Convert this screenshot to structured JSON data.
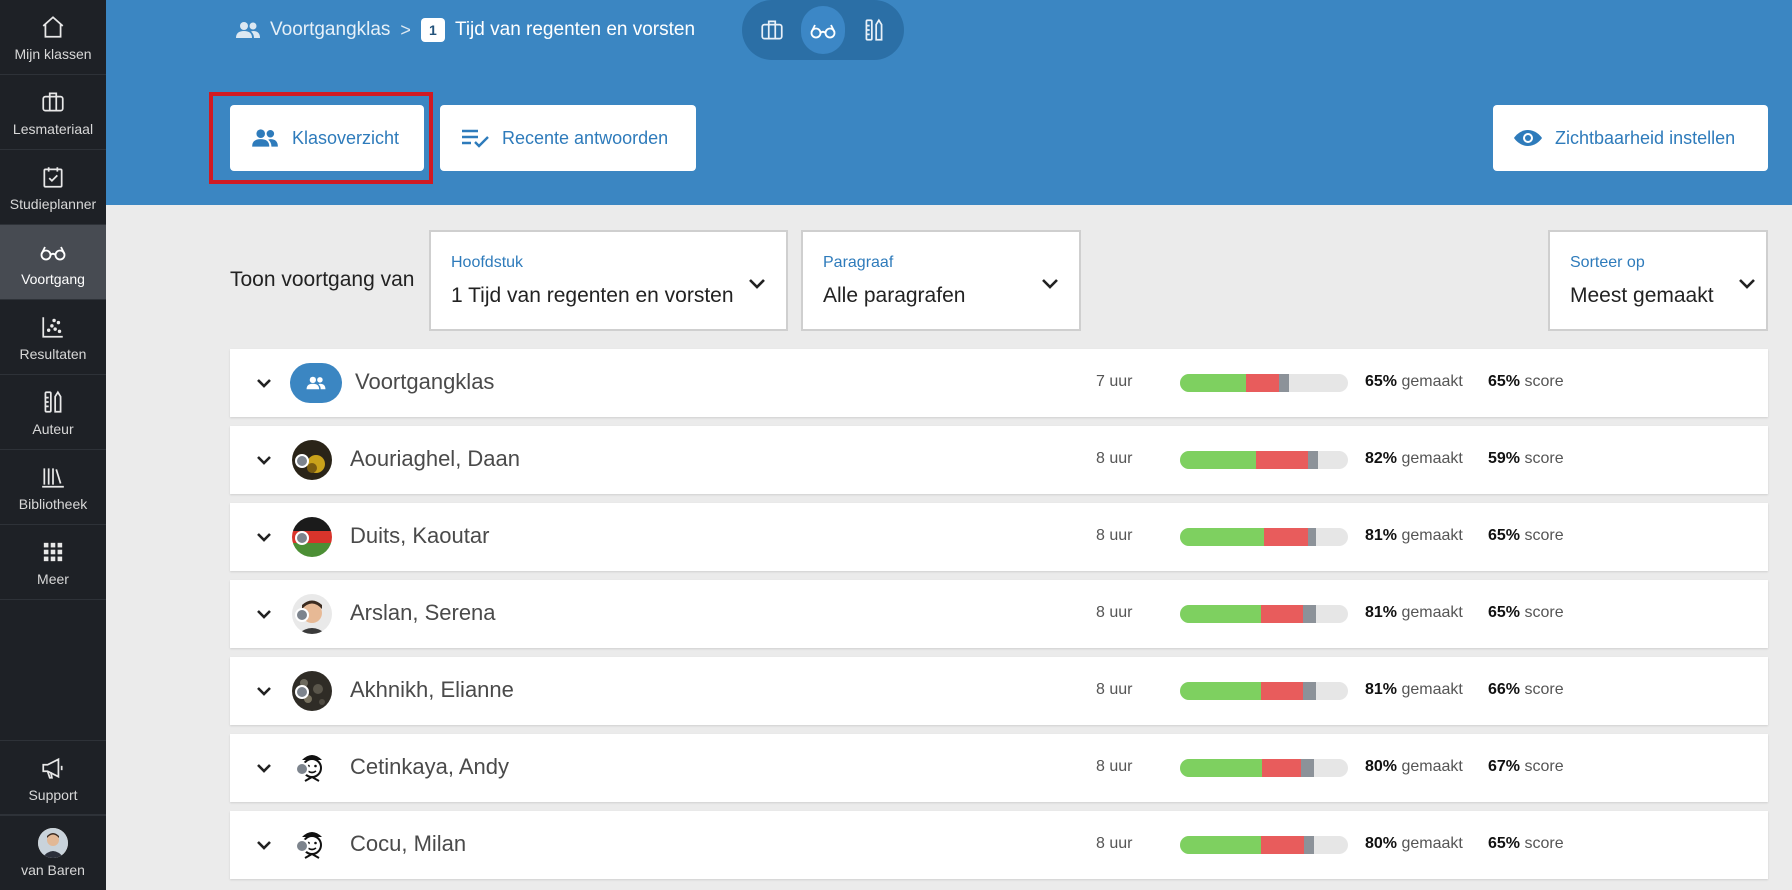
{
  "sidebar": {
    "items": [
      {
        "label": "Mijn klassen",
        "icon": "home-icon"
      },
      {
        "label": "Lesmateriaal",
        "icon": "briefcase-icon"
      },
      {
        "label": "Studieplanner",
        "icon": "calendar-check-icon"
      },
      {
        "label": "Voortgang",
        "icon": "glasses-icon",
        "active": true
      },
      {
        "label": "Resultaten",
        "icon": "scatter-chart-icon"
      },
      {
        "label": "Auteur",
        "icon": "author-tools-icon"
      },
      {
        "label": "Bibliotheek",
        "icon": "library-icon"
      },
      {
        "label": "Meer",
        "icon": "grid-icon"
      },
      {
        "label": "Support",
        "icon": "megaphone-icon"
      }
    ],
    "user": {
      "label": "van Baren"
    }
  },
  "header": {
    "breadcrumb": {
      "class_name": "Voortgangklas",
      "chapter_number": "1",
      "chapter_title": "Tijd van regenten en vorsten"
    },
    "tabs": {
      "class_overview": "Klasoverzicht",
      "recent_answers": "Recente antwoorden"
    },
    "visibility_button": "Zichtbaarheid instellen"
  },
  "filters": {
    "label": "Toon voortgang van",
    "chapter": {
      "caption": "Hoofdstuk",
      "value": "1 Tijd van regenten en vorsten"
    },
    "section": {
      "caption": "Paragraaf",
      "value": "Alle paragrafen"
    },
    "sort": {
      "caption": "Sorteer op",
      "value": "Meest gemaakt"
    }
  },
  "labels": {
    "made": "gemaakt",
    "score": "score"
  },
  "colors": {
    "correct": "#7ed060",
    "incorrect": "#e85c5c",
    "pending": "#8c9299",
    "accent": "#3b86c2"
  },
  "rows": [
    {
      "name": "Voortgangklas",
      "group": true,
      "hours": "7 uur",
      "made": "65%",
      "score": "65%",
      "bar": [
        0.39,
        0.2,
        0.06
      ]
    },
    {
      "name": "Aouriaghel, Daan",
      "hours": "8 uur",
      "made": "82%",
      "score": "59%",
      "bar": [
        0.45,
        0.31,
        0.06
      ]
    },
    {
      "name": "Duits, Kaoutar",
      "hours": "8 uur",
      "made": "81%",
      "score": "65%",
      "bar": [
        0.5,
        0.26,
        0.05
      ]
    },
    {
      "name": "Arslan, Serena",
      "hours": "8 uur",
      "made": "81%",
      "score": "65%",
      "bar": [
        0.48,
        0.25,
        0.08
      ]
    },
    {
      "name": "Akhnikh, Elianne",
      "hours": "8 uur",
      "made": "81%",
      "score": "66%",
      "bar": [
        0.48,
        0.25,
        0.08
      ]
    },
    {
      "name": "Cetinkaya, Andy",
      "hours": "8 uur",
      "made": "80%",
      "score": "67%",
      "bar": [
        0.49,
        0.23,
        0.08
      ]
    },
    {
      "name": "Cocu, Milan",
      "hours": "8 uur",
      "made": "80%",
      "score": "65%",
      "bar": [
        0.48,
        0.26,
        0.06
      ]
    }
  ]
}
